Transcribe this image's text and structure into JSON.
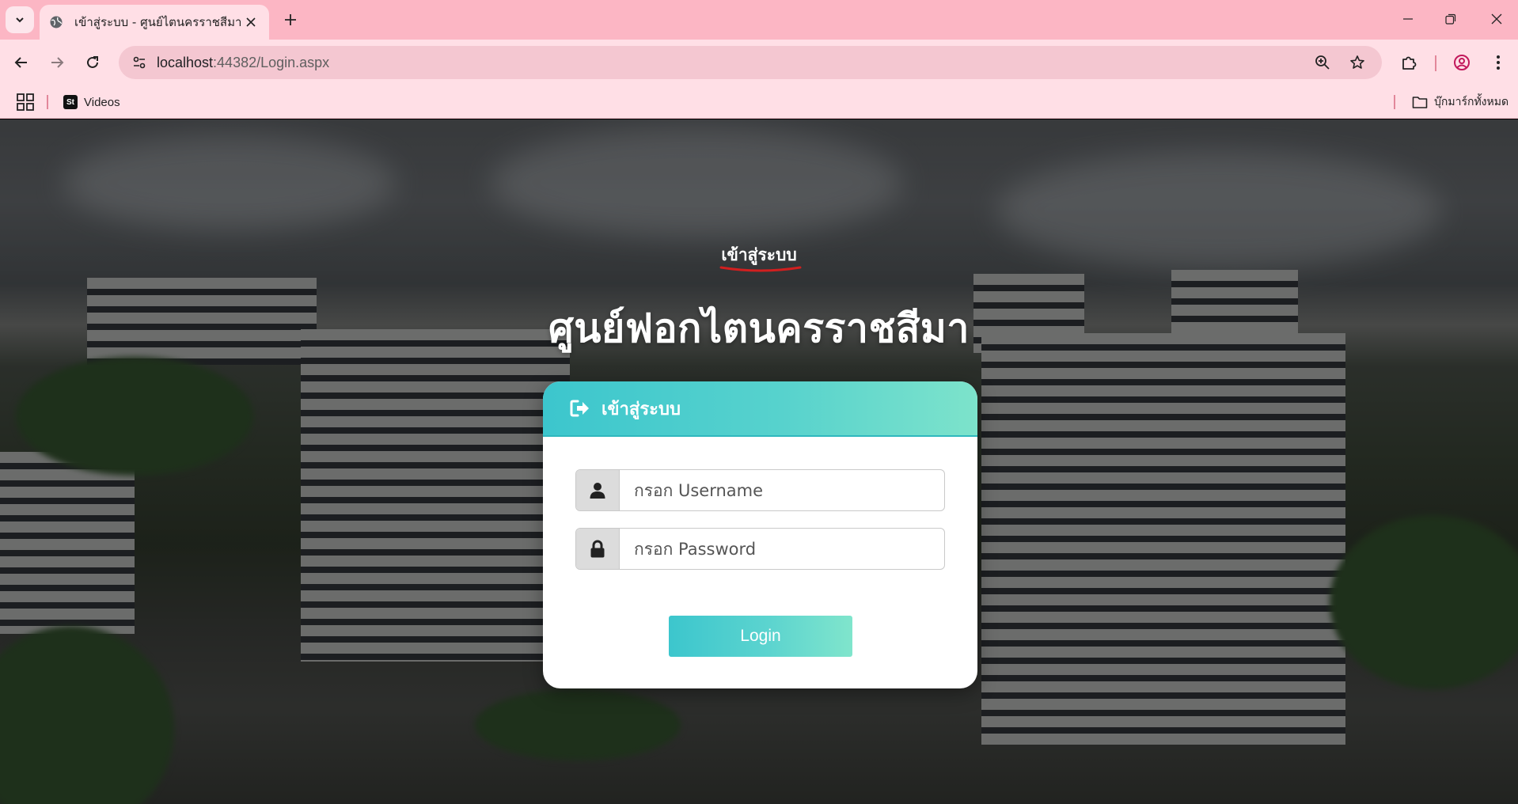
{
  "browser": {
    "tab": {
      "title": "เข้าสู่ระบบ - ศูนย์ไตนครราชสีมา"
    },
    "url": {
      "host": "localhost",
      "port_path": ":44382/Login.aspx"
    },
    "bookmarks": {
      "items": [
        {
          "label": "Videos",
          "icon": "st-logo"
        }
      ],
      "all_bookmarks_label": "บุ๊กมาร์กทั้งหมด"
    },
    "colors": {
      "tab_strip": "#fcb6c4",
      "toolbar": "#ffdfe6",
      "omnibox": "#f4c7d1"
    }
  },
  "page": {
    "sub_title": "เข้าสู่ระบบ",
    "main_title": "ศูนย์ฟอกไตนครราชสีมา",
    "card": {
      "header_title": "เข้าสู่ระบบ",
      "header_icon": "sign-in-icon",
      "username": {
        "placeholder": "กรอก Username",
        "value": "",
        "icon": "user-icon"
      },
      "password": {
        "placeholder": "กรอก Password",
        "value": "",
        "icon": "lock-icon"
      },
      "login_button": "Login"
    },
    "colors": {
      "accent_start": "#3cc6cd",
      "accent_end": "#80e5cc",
      "underline": "#d11f1f"
    }
  }
}
